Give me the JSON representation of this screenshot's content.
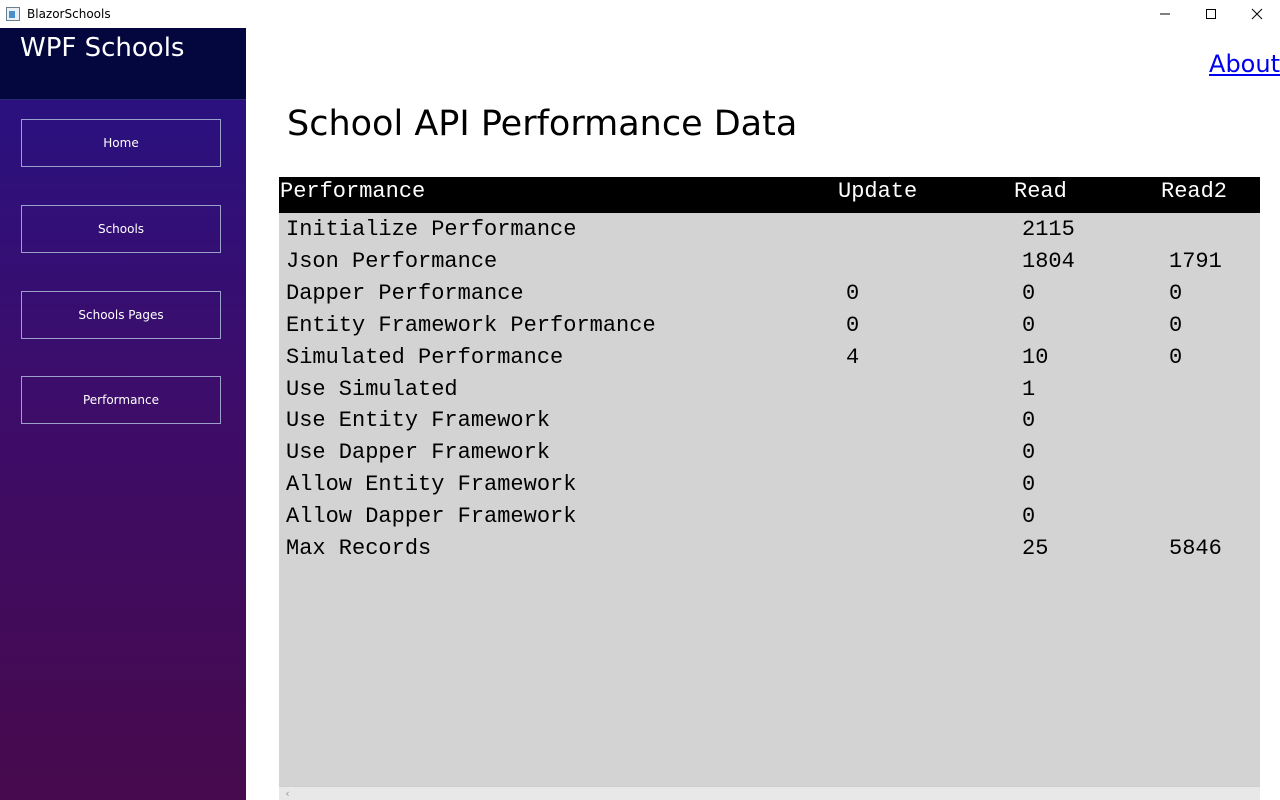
{
  "window": {
    "title": "BlazorSchools",
    "minimize_icon": "minimize-icon",
    "maximize_icon": "maximize-icon",
    "close_icon": "close-icon"
  },
  "sidebar": {
    "brand": "WPF Schools",
    "items": [
      {
        "label": "Home"
      },
      {
        "label": "Schools"
      },
      {
        "label": "Schools Pages"
      },
      {
        "label": "Performance"
      }
    ]
  },
  "header": {
    "about": "About"
  },
  "main": {
    "title": "School API Performance Data"
  },
  "table": {
    "headers": [
      "Performance",
      "Update",
      "Read",
      "Read2"
    ],
    "rows": [
      [
        "Initialize Performance",
        "",
        "2115",
        ""
      ],
      [
        "Json Performance",
        "",
        "1804",
        "1791"
      ],
      [
        "Dapper Performance",
        "0",
        "0",
        "0"
      ],
      [
        "Entity Framework Performance",
        "0",
        "0",
        "0"
      ],
      [
        "Simulated Performance",
        "4",
        "10",
        "0"
      ],
      [
        "Use Simulated",
        "",
        "1",
        ""
      ],
      [
        "Use Entity Framework",
        "",
        "0",
        ""
      ],
      [
        "Use Dapper Framework",
        "",
        "0",
        ""
      ],
      [
        "Allow Entity Framework",
        "",
        "0",
        ""
      ],
      [
        "Allow Dapper Framework",
        "",
        "0",
        ""
      ],
      [
        "Max Records",
        "",
        "25",
        "5846"
      ]
    ]
  },
  "scrollbar": {
    "left_arrow": "‹"
  },
  "colors": {
    "sidebar_header": "#03073d",
    "sidebar_top": "#2a117f",
    "sidebar_bottom": "#470a4d",
    "grid_background": "#d3d3d3",
    "grid_header": "#000000",
    "link": "#0000ee"
  }
}
